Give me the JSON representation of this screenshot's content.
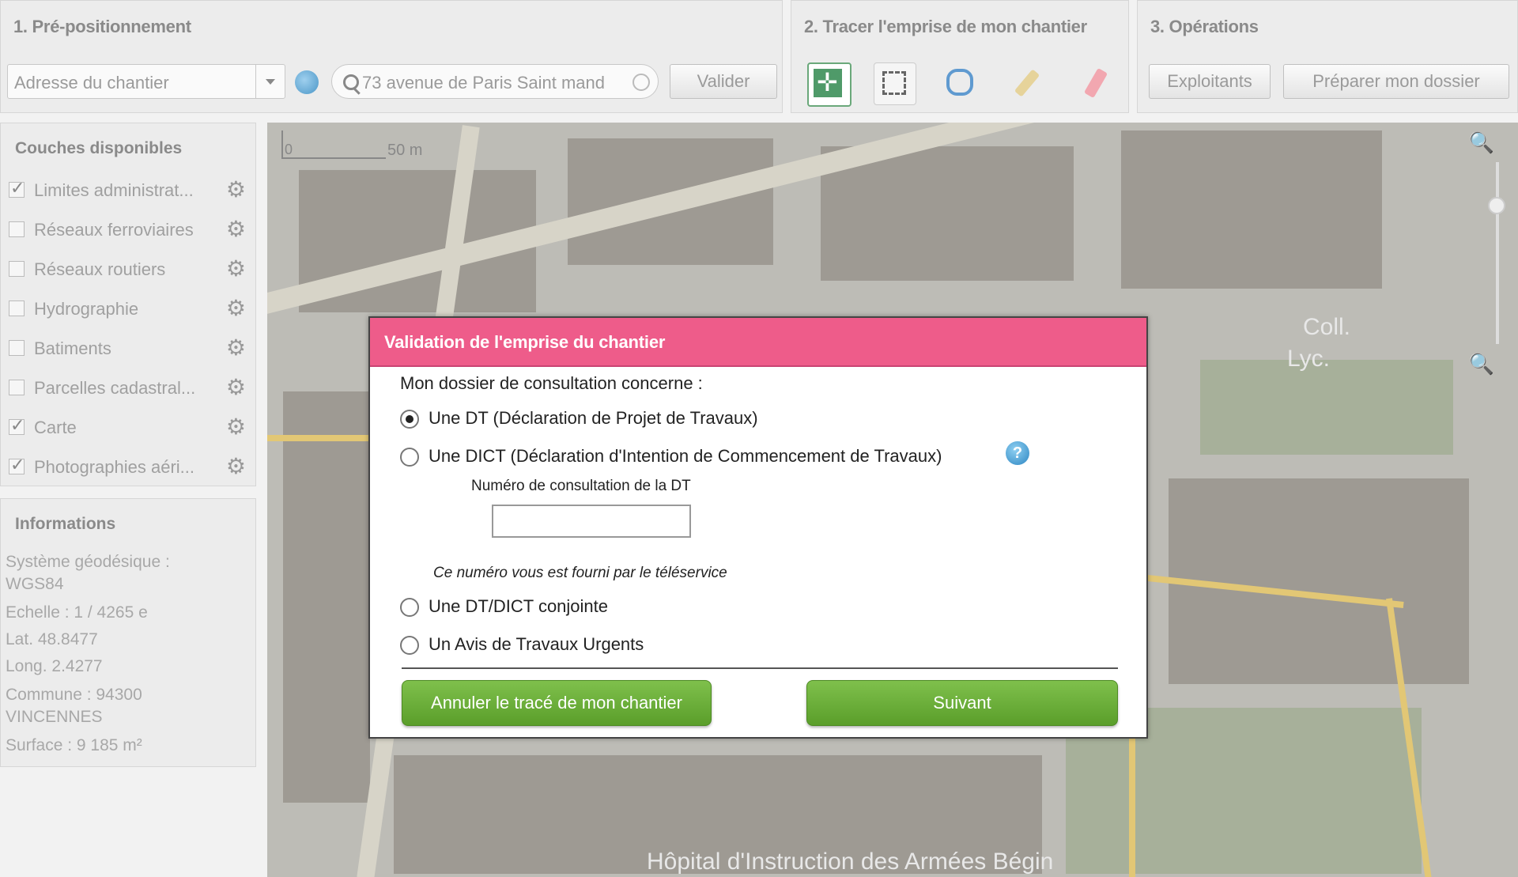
{
  "toolbar": {
    "section1_title": "1. Pré-positionnement",
    "address_type": "Adresse du chantier",
    "search_value": "73 avenue de Paris Saint mand",
    "validate_label": "Valider",
    "section2_title": "2. Tracer l'emprise de mon chantier",
    "section3_title": "3. Opérations",
    "exploitants_label": "Exploitants",
    "prepare_label": "Préparer mon dossier"
  },
  "layers": {
    "title": "Couches disponibles",
    "items": [
      {
        "label": "Limites administrat...",
        "checked": true
      },
      {
        "label": "Réseaux ferroviaires",
        "checked": false
      },
      {
        "label": "Réseaux routiers",
        "checked": false
      },
      {
        "label": "Hydrographie",
        "checked": false
      },
      {
        "label": "Batiments",
        "checked": false
      },
      {
        "label": "Parcelles cadastral...",
        "checked": false
      },
      {
        "label": "Carte",
        "checked": true
      },
      {
        "label": "Photographies aéri...",
        "checked": true
      }
    ]
  },
  "info": {
    "title": "Informations",
    "lines": [
      "Système géodésique :",
      "WGS84",
      "Echelle : 1 / 4265 e",
      "Lat. 48.8477",
      "Long. 2.4277",
      "Commune : 94300",
      "VINCENNES",
      "Surface : 9 185 m²"
    ]
  },
  "map": {
    "scale_zero": "0",
    "scale_label": "50 m",
    "labels": [
      "Hôpital d'Instruction des Armées Bégin",
      "Coll.",
      "Lyc."
    ]
  },
  "modal": {
    "title": "Validation de l'emprise du chantier",
    "question": "Mon dossier de consultation concerne :",
    "options": [
      {
        "label": "Une DT (Déclaration de Projet de Travaux)",
        "selected": true
      },
      {
        "label": "Une DICT (Déclaration d'Intention de Commencement de Travaux)",
        "selected": false
      },
      {
        "label": "Une DT/DICT conjointe",
        "selected": false
      },
      {
        "label": "Un Avis de Travaux Urgents",
        "selected": false
      }
    ],
    "help_glyph": "?",
    "dt_number_label": "Numéro de consultation de la DT",
    "dt_number_value": "",
    "dt_number_hint": "Ce numéro vous est fourni par le téléservice",
    "cancel_label": "Annuler le tracé de mon chantier",
    "next_label": "Suivant"
  },
  "colors": {
    "modal_header": "#ee5c8a",
    "primary_button": "#6aaf3a",
    "map_road_yellow": "#e2c775"
  }
}
